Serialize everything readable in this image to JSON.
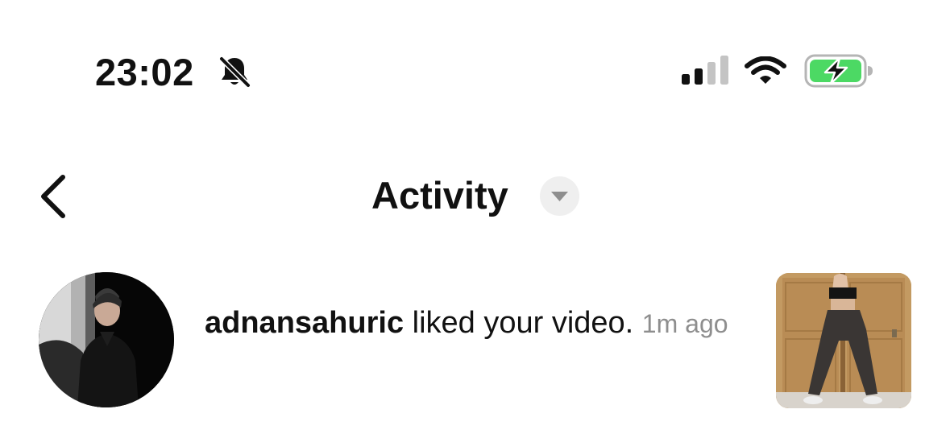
{
  "status_bar": {
    "time": "23:02",
    "icons": [
      "bell-slash-icon",
      "cellular-signal-icon",
      "wifi-icon",
      "battery-charging-icon"
    ],
    "battery_color": "#4cd964"
  },
  "header": {
    "back_icon": "chevron-left-icon",
    "title": "Activity",
    "dropdown_icon": "caret-down-icon"
  },
  "notifications": [
    {
      "username": "adnansahuric",
      "action": " liked your video. ",
      "time": "1m ago",
      "avatar_icon": "user-avatar",
      "thumbnail_icon": "video-thumbnail"
    }
  ],
  "colors": {
    "text": "#111111",
    "secondary_text": "#8e8e8e",
    "dropdown_bg": "#efefef"
  }
}
